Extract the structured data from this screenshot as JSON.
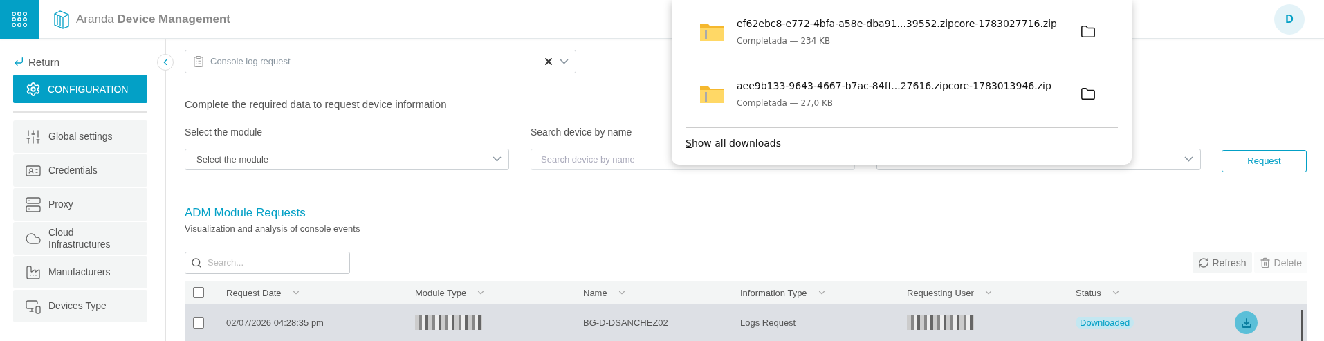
{
  "header": {
    "brand_light": "Aranda",
    "brand_bold": "Device Management",
    "avatar": "D"
  },
  "sidebar": {
    "return": "Return",
    "config": "CONFIGURATION",
    "items": [
      {
        "label": "Global settings"
      },
      {
        "label": "Credentials"
      },
      {
        "label": "Proxy"
      },
      {
        "label": "Cloud Infrastructures"
      },
      {
        "label": "Manufacturers"
      },
      {
        "label": "Devices Type"
      }
    ]
  },
  "tool_select": {
    "value": "Console log request"
  },
  "form": {
    "heading": "Complete the required data to request device information",
    "fields": [
      {
        "kind": "select",
        "label": "Select the module",
        "value": "Select the module"
      },
      {
        "kind": "search",
        "label": "Search device by name",
        "placeholder": "Search device by name"
      },
      {
        "kind": "select"
      }
    ],
    "button": "Request"
  },
  "requests": {
    "title": "ADM Module Requests",
    "subtitle": "Visualization and analysis of console events",
    "search_placeholder": "Search...",
    "actions": [
      {
        "label": "Refresh",
        "disabled": false
      },
      {
        "label": "Delete",
        "disabled": true
      }
    ],
    "header_checked": false,
    "columns": [
      "Request Date",
      "Module Type",
      "Name",
      "Information Type",
      "Requesting User",
      "Status"
    ],
    "rows": [
      {
        "checked": false,
        "highlighted": true,
        "cells": [
          {
            "kind": "text",
            "text": "02/07/2026 04:28:35 pm"
          },
          {
            "kind": "redacted"
          },
          {
            "kind": "text",
            "text": "BG-D-DSANCHEZ02"
          },
          {
            "kind": "text",
            "text": "Logs Request"
          },
          {
            "kind": "redacted"
          },
          {
            "kind": "badge",
            "text": "Downloaded"
          }
        ]
      }
    ]
  },
  "downloads": {
    "items": [
      {
        "file": "ef62ebc8-e772-4bfa-a58e-dba91...39552.zipcore-1783027716.zip",
        "status": "Completada — 234 KB"
      },
      {
        "file": "aee9b133-9643-4667-b7ac-84ff...27616.zipcore-1783013946.zip",
        "status": "Completada — 27,0 KB"
      }
    ],
    "show_all": "Show all downloads"
  }
}
